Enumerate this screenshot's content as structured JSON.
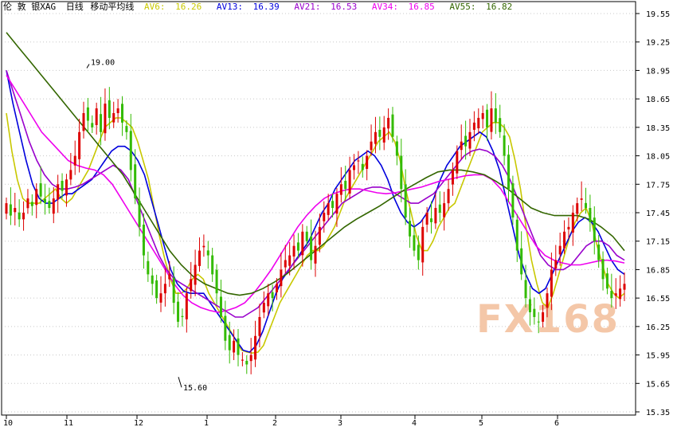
{
  "legend": {
    "title": "伦 敦 银XAG",
    "period": "日线",
    "indicator": "移动平均线",
    "items": [
      {
        "label": "AV6:",
        "value": "16.26",
        "color": "#c8c800"
      },
      {
        "label": "AV13:",
        "value": "16.39",
        "color": "#0000dd"
      },
      {
        "label": "AV21:",
        "value": "16.53",
        "color": "#9900cc"
      },
      {
        "label": "AV34:",
        "value": "16.85",
        "color": "#ee00ee"
      },
      {
        "label": "AV55:",
        "value": "16.82",
        "color": "#336600"
      }
    ]
  },
  "watermark": "FX168",
  "chart_data": {
    "type": "candlestick",
    "instrument": "伦 敦 银XAG",
    "period": "日线",
    "ylim": [
      15.35,
      19.55
    ],
    "yticks": [
      "19.55",
      "19.25",
      "18.95",
      "18.65",
      "18.35",
      "18.05",
      "17.75",
      "17.45",
      "17.15",
      "16.85",
      "16.55",
      "16.25",
      "15.95",
      "15.65",
      "15.35"
    ],
    "xticks": [
      "10",
      "11",
      "12",
      "1",
      "2",
      "3",
      "4",
      "5",
      "6"
    ],
    "annotations": [
      {
        "text": "19.00",
        "value": 19.0
      },
      {
        "text": "15.60",
        "value": 15.6
      }
    ],
    "up_color": "#dd0000",
    "down_color": "#33bb00",
    "moving_averages": [
      {
        "name": "AV6",
        "last": 16.26,
        "color": "#c8c800"
      },
      {
        "name": "AV13",
        "last": 16.39,
        "color": "#0000dd"
      },
      {
        "name": "AV21",
        "last": 16.53,
        "color": "#9900cc"
      },
      {
        "name": "AV34",
        "last": 16.85,
        "color": "#ee00ee"
      },
      {
        "name": "AV55",
        "last": 16.82,
        "color": "#336600"
      }
    ],
    "closes": [
      17.55,
      17.42,
      17.5,
      17.38,
      17.45,
      17.6,
      17.52,
      17.7,
      17.62,
      17.55,
      17.5,
      17.6,
      17.75,
      17.68,
      17.8,
      17.9,
      18.05,
      18.3,
      18.5,
      18.42,
      18.35,
      18.55,
      18.3,
      18.6,
      18.45,
      18.5,
      18.55,
      18.4,
      18.3,
      17.9,
      17.6,
      17.3,
      17.0,
      16.8,
      16.7,
      16.55,
      16.6,
      16.7,
      16.8,
      16.5,
      16.3,
      16.35,
      16.6,
      16.75,
      16.9,
      17.05,
      17.1,
      17.0,
      16.8,
      16.6,
      16.35,
      16.1,
      16.0,
      16.1,
      15.95,
      15.9,
      15.85,
      15.95,
      16.15,
      16.35,
      16.5,
      16.6,
      16.55,
      16.7,
      16.85,
      16.95,
      17.0,
      17.1,
      17.05,
      17.25,
      17.15,
      16.95,
      17.1,
      17.3,
      17.45,
      17.55,
      17.5,
      17.65,
      17.75,
      17.7,
      17.9,
      17.95,
      18.0,
      17.9,
      18.05,
      18.2,
      18.3,
      18.25,
      18.35,
      18.45,
      18.25,
      18.05,
      17.7,
      17.4,
      17.2,
      17.05,
      16.95,
      17.3,
      17.45,
      17.35,
      17.5,
      17.45,
      17.55,
      17.7,
      17.9,
      18.1,
      18.2,
      18.15,
      18.3,
      18.4,
      18.45,
      18.5,
      18.35,
      18.55,
      18.4,
      18.3,
      18.05,
      17.7,
      17.4,
      17.05,
      16.8,
      16.55,
      16.4,
      16.35,
      16.3,
      16.4,
      16.6,
      16.85,
      16.95,
      17.1,
      17.25,
      17.3,
      17.45,
      17.55,
      17.6,
      17.5,
      17.35,
      17.15,
      16.95,
      16.75,
      16.65,
      16.55,
      16.6,
      16.65,
      16.7
    ],
    "ma_values": {
      "AV6": [
        18.5,
        18.1,
        17.8,
        17.6,
        17.55,
        17.55,
        17.55,
        17.6,
        17.65,
        17.7,
        17.6,
        17.55,
        17.6,
        17.7,
        17.8,
        17.9,
        18.05,
        18.2,
        18.35,
        18.4,
        18.45,
        18.45,
        18.4,
        18.35,
        18.2,
        18.0,
        17.8,
        17.5,
        17.2,
        16.95,
        16.75,
        16.6,
        16.6,
        16.65,
        16.75,
        16.8,
        16.75,
        16.6,
        16.5,
        16.4,
        16.3,
        16.2,
        16.1,
        16.0,
        15.98,
        15.97,
        15.98,
        16.05,
        16.2,
        16.35,
        16.5,
        16.6,
        16.7,
        16.8,
        16.9,
        17.0,
        17.05,
        17.05,
        17.1,
        17.2,
        17.3,
        17.45,
        17.6,
        17.7,
        17.8,
        17.9,
        18.0,
        18.1,
        18.2,
        18.25,
        18.3,
        18.2,
        18.0,
        17.7,
        17.45,
        17.2,
        17.05,
        17.05,
        17.15,
        17.3,
        17.4,
        17.5,
        17.55,
        17.7,
        17.85,
        18.0,
        18.15,
        18.3,
        18.35,
        18.4,
        18.4,
        18.35,
        18.25,
        18.0,
        17.7,
        17.3,
        16.95,
        16.7,
        16.5,
        16.45,
        16.6,
        16.8,
        17.0,
        17.2,
        17.35,
        17.45,
        17.5,
        17.35,
        17.1,
        16.9,
        16.7,
        16.6,
        16.55,
        16.6
      ],
      "AV13": [
        18.95,
        18.6,
        18.3,
        18.0,
        17.75,
        17.6,
        17.55,
        17.55,
        17.6,
        17.65,
        17.65,
        17.7,
        17.75,
        17.8,
        17.9,
        18.0,
        18.1,
        18.15,
        18.15,
        18.1,
        18.0,
        17.85,
        17.6,
        17.35,
        17.1,
        16.85,
        16.7,
        16.62,
        16.6,
        16.6,
        16.6,
        16.5,
        16.4,
        16.3,
        16.2,
        16.1,
        16.0,
        15.98,
        16.05,
        16.2,
        16.4,
        16.6,
        16.75,
        16.85,
        16.95,
        17.05,
        17.15,
        17.3,
        17.45,
        17.55,
        17.7,
        17.8,
        17.9,
        18.0,
        18.05,
        18.1,
        18.05,
        17.95,
        17.8,
        17.6,
        17.45,
        17.35,
        17.3,
        17.35,
        17.45,
        17.6,
        17.8,
        17.95,
        18.05,
        18.15,
        18.2,
        18.25,
        18.3,
        18.25,
        18.1,
        17.9,
        17.6,
        17.3,
        17.0,
        16.8,
        16.65,
        16.6,
        16.65,
        16.8,
        16.95,
        17.1,
        17.25,
        17.35,
        17.4,
        17.35,
        17.25,
        17.1,
        16.95,
        16.85,
        16.8
      ],
      "AV21": [
        18.95,
        18.7,
        18.45,
        18.2,
        18.0,
        17.85,
        17.75,
        17.7,
        17.7,
        17.72,
        17.75,
        17.8,
        17.85,
        17.9,
        17.95,
        17.9,
        17.8,
        17.6,
        17.4,
        17.2,
        17.0,
        16.85,
        16.75,
        16.7,
        16.65,
        16.6,
        16.55,
        16.5,
        16.45,
        16.4,
        16.35,
        16.35,
        16.4,
        16.45,
        16.55,
        16.65,
        16.75,
        16.85,
        16.95,
        17.05,
        17.15,
        17.25,
        17.35,
        17.45,
        17.55,
        17.6,
        17.65,
        17.7,
        17.72,
        17.72,
        17.7,
        17.65,
        17.6,
        17.55,
        17.55,
        17.6,
        17.65,
        17.75,
        17.85,
        17.95,
        18.05,
        18.1,
        18.12,
        18.1,
        18.05,
        17.95,
        17.8,
        17.6,
        17.4,
        17.2,
        17.0,
        16.9,
        16.85,
        16.85,
        16.9,
        17.0,
        17.1,
        17.15,
        17.15,
        17.1,
        17.0,
        16.95
      ],
      "AV34": [
        18.9,
        18.75,
        18.6,
        18.45,
        18.3,
        18.2,
        18.1,
        18.0,
        17.95,
        17.92,
        17.9,
        17.85,
        17.75,
        17.6,
        17.45,
        17.3,
        17.15,
        17.0,
        16.85,
        16.7,
        16.58,
        16.5,
        16.45,
        16.42,
        16.4,
        16.42,
        16.45,
        16.5,
        16.6,
        16.72,
        16.85,
        17.0,
        17.15,
        17.3,
        17.42,
        17.52,
        17.6,
        17.65,
        17.68,
        17.7,
        17.7,
        17.68,
        17.66,
        17.65,
        17.66,
        17.68,
        17.7,
        17.72,
        17.75,
        17.78,
        17.8,
        17.82,
        17.84,
        17.85,
        17.85,
        17.8,
        17.7,
        17.55,
        17.4,
        17.25,
        17.1,
        17.0,
        16.95,
        16.92,
        16.9,
        16.9,
        16.92,
        16.94,
        16.95,
        16.94,
        16.92
      ],
      "AV55": [
        19.35,
        19.2,
        19.05,
        18.9,
        18.75,
        18.6,
        18.45,
        18.3,
        18.15,
        18.0,
        17.85,
        17.65,
        17.45,
        17.25,
        17.05,
        16.9,
        16.78,
        16.7,
        16.65,
        16.6,
        16.58,
        16.6,
        16.65,
        16.72,
        16.8,
        16.9,
        17.0,
        17.1,
        17.2,
        17.3,
        17.38,
        17.45,
        17.52,
        17.6,
        17.68,
        17.75,
        17.82,
        17.88,
        17.9,
        17.9,
        17.88,
        17.85,
        17.78,
        17.7,
        17.6,
        17.5,
        17.45,
        17.42,
        17.42,
        17.42,
        17.38,
        17.3,
        17.2,
        17.05
      ]
    }
  }
}
